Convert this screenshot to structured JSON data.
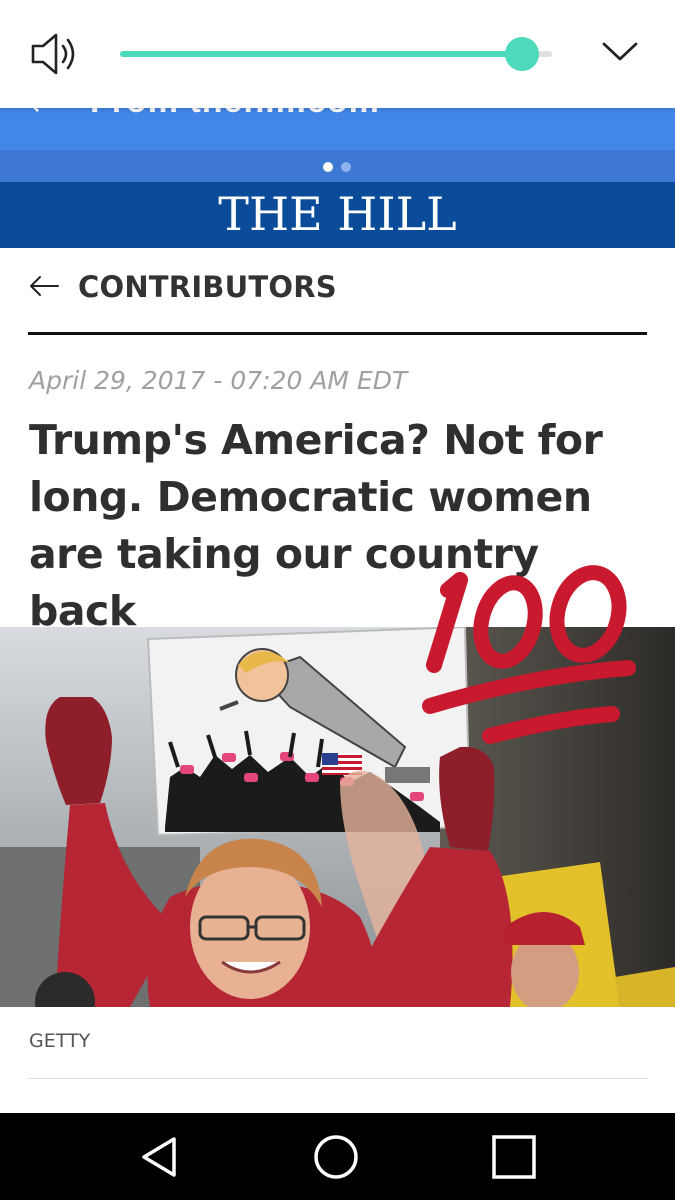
{
  "volume": {
    "level": 0.93,
    "accent_color": "#4dd9bc",
    "speaker_icon": "speaker-icon",
    "collapse_icon": "chevron-down-icon"
  },
  "banner": {
    "text": "From thehill.com",
    "page_count": 2,
    "active_page": 1,
    "color": "#4286e8"
  },
  "site": {
    "logo": "THE HILL",
    "brand_color": "#0a4b9a"
  },
  "section": {
    "back_icon": "arrow-left-icon",
    "title": "CONTRIBUTORS"
  },
  "article": {
    "dateline": "April 29, 2017 - 07:20 AM EDT",
    "headline": "Trump's America? Not for long. Democratic women are taking our country back",
    "photo_credit": "GETTY"
  },
  "overlay": {
    "emoji": "hundred-points-emoji",
    "color": "#c8192e"
  },
  "nav": {
    "back_icon": "nav-back-icon",
    "home_icon": "nav-home-icon",
    "recents_icon": "nav-recents-icon"
  }
}
